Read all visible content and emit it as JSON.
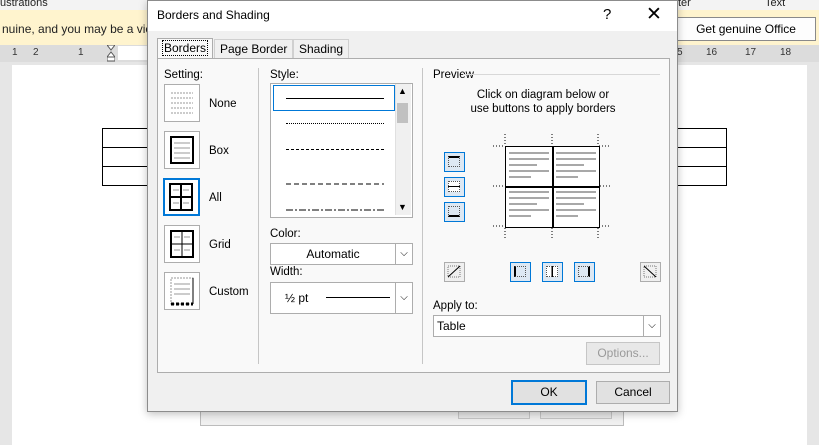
{
  "word": {
    "ribbon_left": "ustrations",
    "ribbon_mid": "ter",
    "ribbon_right": "Text",
    "info_text": "nuine, and you may be a vic",
    "genuine_button": "Get genuine Office",
    "ruler_left": [
      "1",
      "2",
      "1"
    ],
    "ruler_right": [
      "5",
      "16",
      "17",
      "18"
    ],
    "ghost_ok": "OK",
    "ghost_cancel": "Cancel"
  },
  "dialog": {
    "title": "Borders and Shading",
    "help": "?",
    "close": "✕",
    "tabs": [
      {
        "label": "Borders",
        "active": true
      },
      {
        "label": "Page Border",
        "active": false
      },
      {
        "label": "Shading",
        "active": false
      }
    ],
    "setting_label": "Setting:",
    "settings": [
      {
        "label": "None",
        "icon": "setting-none-icon",
        "selected": false
      },
      {
        "label": "Box",
        "icon": "setting-box-icon",
        "selected": false
      },
      {
        "label": "All",
        "icon": "setting-all-icon",
        "selected": true
      },
      {
        "label": "Grid",
        "icon": "setting-grid-icon",
        "selected": false
      },
      {
        "label": "Custom",
        "icon": "setting-custom-icon",
        "selected": false
      }
    ],
    "style_label": "Style:",
    "color_label": "Color:",
    "color_value": "Automatic",
    "width_label": "Width:",
    "width_value": "½ pt",
    "preview_label": "Preview",
    "preview_instructions": "Click on diagram below or\nuse buttons to apply borders",
    "apply_to_label": "Apply to:",
    "apply_to_value": "Table",
    "options_button": "Options...",
    "ok_button": "OK",
    "cancel_button": "Cancel",
    "accent": "#0078d7"
  }
}
